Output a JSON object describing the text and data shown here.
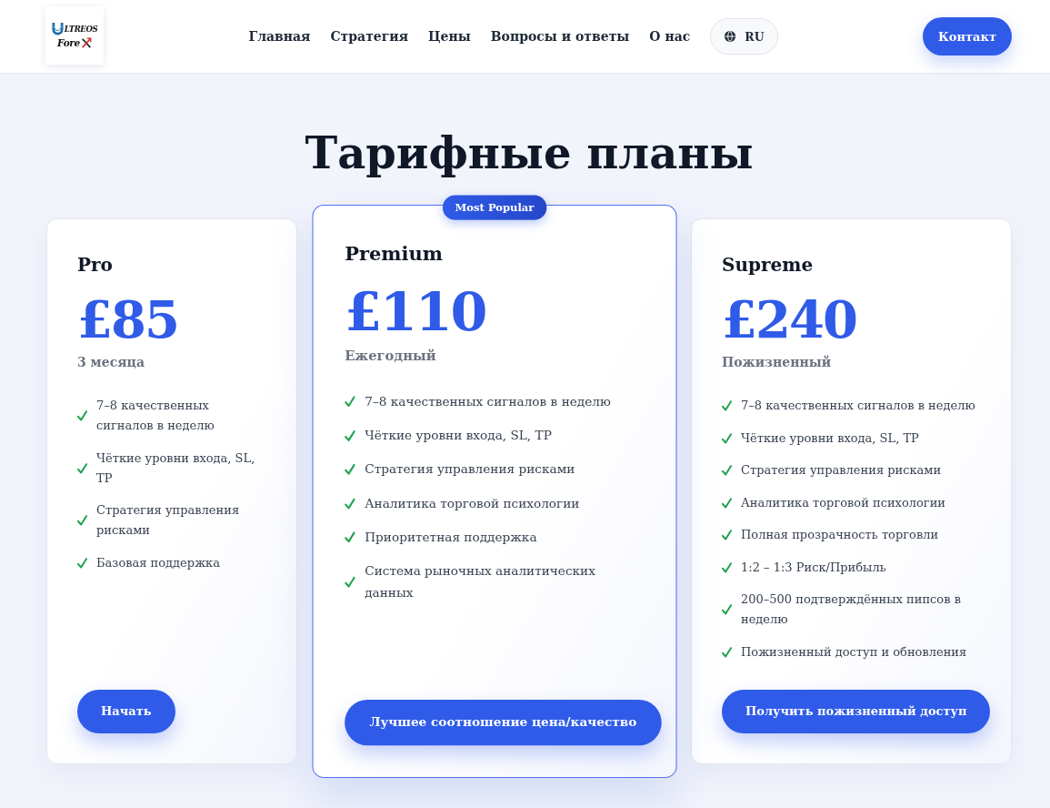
{
  "header": {
    "logo": {
      "line_1": "LTREOS",
      "line_2": "Fore"
    },
    "nav": [
      "Главная",
      "Стратегия",
      "Цены",
      "Вопросы и ответы",
      "О нас"
    ],
    "language": "RU",
    "contact_button": "Контакт"
  },
  "pricing": {
    "title": "Тарифные планы",
    "plans": [
      {
        "name": "Pro",
        "price": "£85",
        "period": "3 месяца",
        "highlighted": false,
        "features": [
          "7–8 качественных сигналов в неделю",
          "Чёткие уровни входа, SL, TP",
          "Стратегия управления рисками",
          "Базовая поддержка"
        ],
        "button": "Начать"
      },
      {
        "badge": "Most Popular",
        "name": "Premium",
        "price": "£110",
        "period": "Ежегодный",
        "highlighted": true,
        "features": [
          "7–8 качественных сигналов в неделю",
          "Чёткие уровни входа, SL, TP",
          "Стратегия управления рисками",
          "Аналитика торговой психологии",
          "Приоритетная поддержка",
          "Система рыночных аналитических данных"
        ],
        "button": "Лучшее соотношение цена/качество"
      },
      {
        "name": "Supreme",
        "price": "£240",
        "period": "Пожизненный",
        "highlighted": false,
        "features": [
          "7–8 качественных сигналов в неделю",
          "Чёткие уровни входа, SL, TP",
          "Стратегия управления рисками",
          "Аналитика торговой психологии",
          "Полная прозрачность торговли",
          "1:2 – 1:3 Риск/Прибыль",
          "200–500 подтверждённых пипсов в неделю",
          "Пожизненный доступ и обновления"
        ],
        "button": "Получить пожизненный доступ"
      }
    ]
  }
}
